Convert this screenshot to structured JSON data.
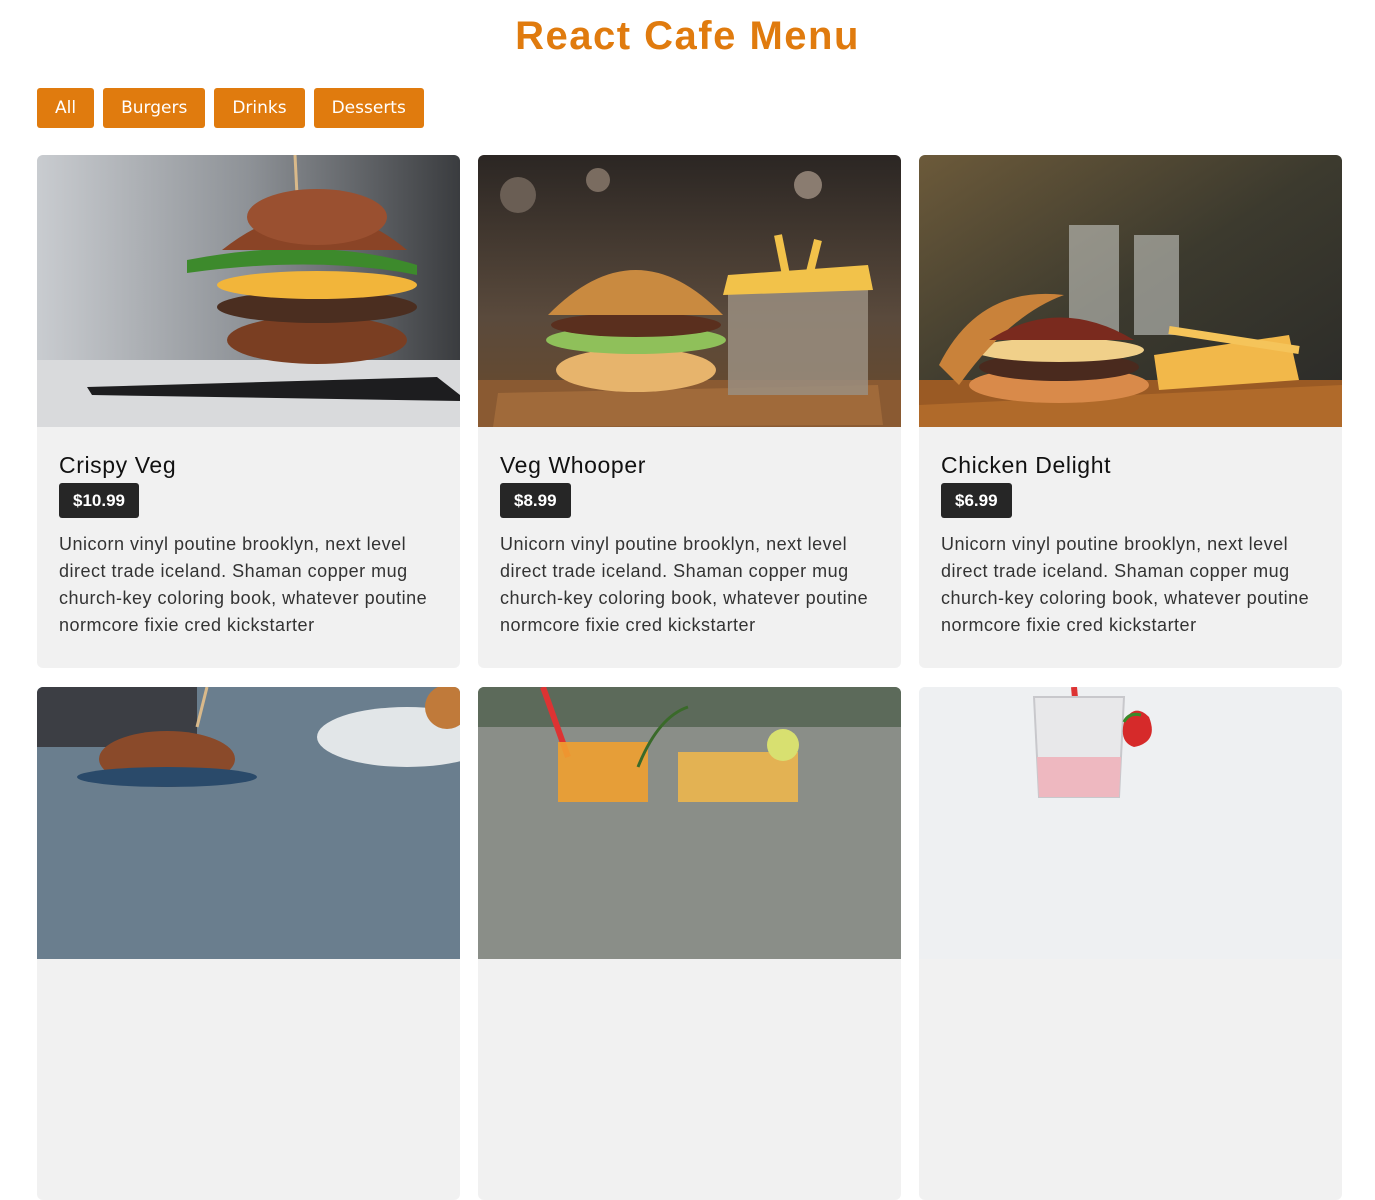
{
  "header": {
    "title": "React Cafe Menu"
  },
  "filters": [
    {
      "label": "All"
    },
    {
      "label": "Burgers"
    },
    {
      "label": "Drinks"
    },
    {
      "label": "Desserts"
    }
  ],
  "items": [
    {
      "title": "Crispy Veg",
      "price": "$10.99",
      "desc": "Unicorn vinyl poutine brooklyn, next level direct trade iceland. Shaman copper mug church-key coloring book, whatever poutine normcore fixie cred kickstarter",
      "image": "burger-photo"
    },
    {
      "title": "Veg Whooper",
      "price": "$8.99",
      "desc": "Unicorn vinyl poutine brooklyn, next level direct trade iceland. Shaman copper mug church-key coloring book, whatever poutine normcore fixie cred kickstarter",
      "image": "burger-fries-photo"
    },
    {
      "title": "Chicken Delight",
      "price": "$6.99",
      "desc": "Unicorn vinyl poutine brooklyn, next level direct trade iceland. Shaman copper mug church-key coloring book, whatever poutine normcore fixie cred kickstarter",
      "image": "burger-board-photo"
    },
    {
      "image": "burger-table-photo"
    },
    {
      "image": "drinks-photo"
    },
    {
      "image": "milkshake-photo"
    }
  ],
  "colors": {
    "accent": "#e07b0e",
    "card_bg": "#f1f1f1",
    "price_bg": "#262626"
  }
}
